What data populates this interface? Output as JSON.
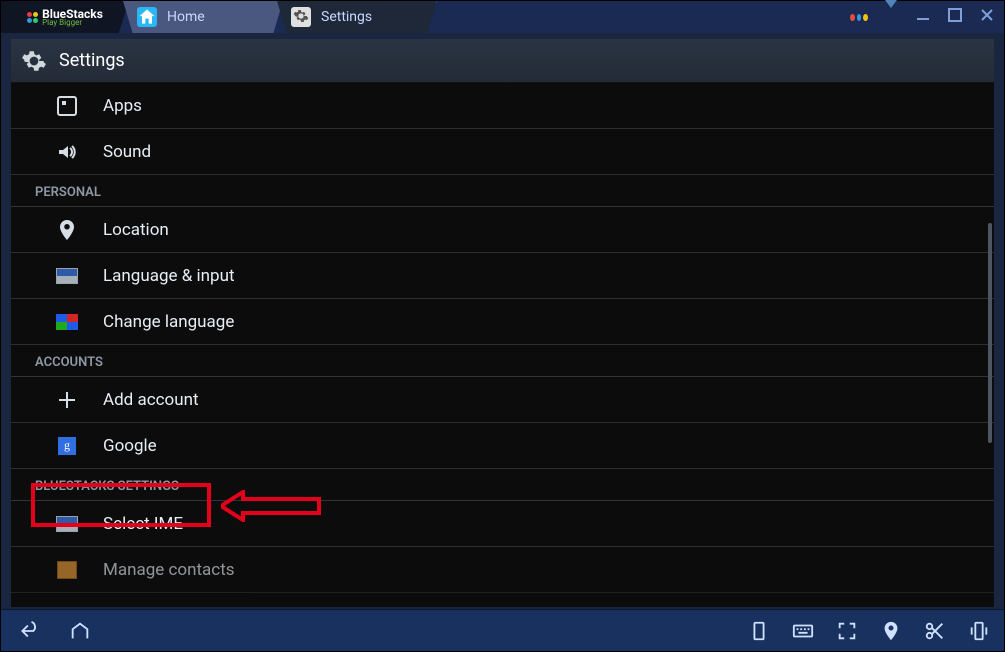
{
  "titlebar": {
    "logo_text": "BlueStacks",
    "logo_sub": "Play Bigger",
    "tabs": [
      {
        "label": "Home",
        "icon": "home-icon"
      },
      {
        "label": "Settings",
        "icon": "settings-icon"
      }
    ]
  },
  "header": {
    "title": "Settings"
  },
  "settings_list": {
    "items_top": [
      {
        "label": "Apps",
        "icon": "apps-icon"
      },
      {
        "label": "Sound",
        "icon": "sound-icon"
      }
    ],
    "section_personal": "PERSONAL",
    "personal_items": [
      {
        "label": "Location",
        "icon": "location-icon"
      },
      {
        "label": "Language & input",
        "icon": "keyboard-icon"
      },
      {
        "label": "Change language",
        "icon": "flags-icon"
      }
    ],
    "section_accounts": "ACCOUNTS",
    "accounts_items": [
      {
        "label": "Add account",
        "icon": "plus-icon"
      },
      {
        "label": "Google",
        "icon": "google-icon"
      }
    ],
    "section_bs": "BLUESTACKS SETTINGS",
    "bs_items": [
      {
        "label": "Select IME",
        "icon": "keyboard-icon"
      },
      {
        "label": "Manage contacts",
        "icon": "contacts-icon"
      }
    ]
  }
}
